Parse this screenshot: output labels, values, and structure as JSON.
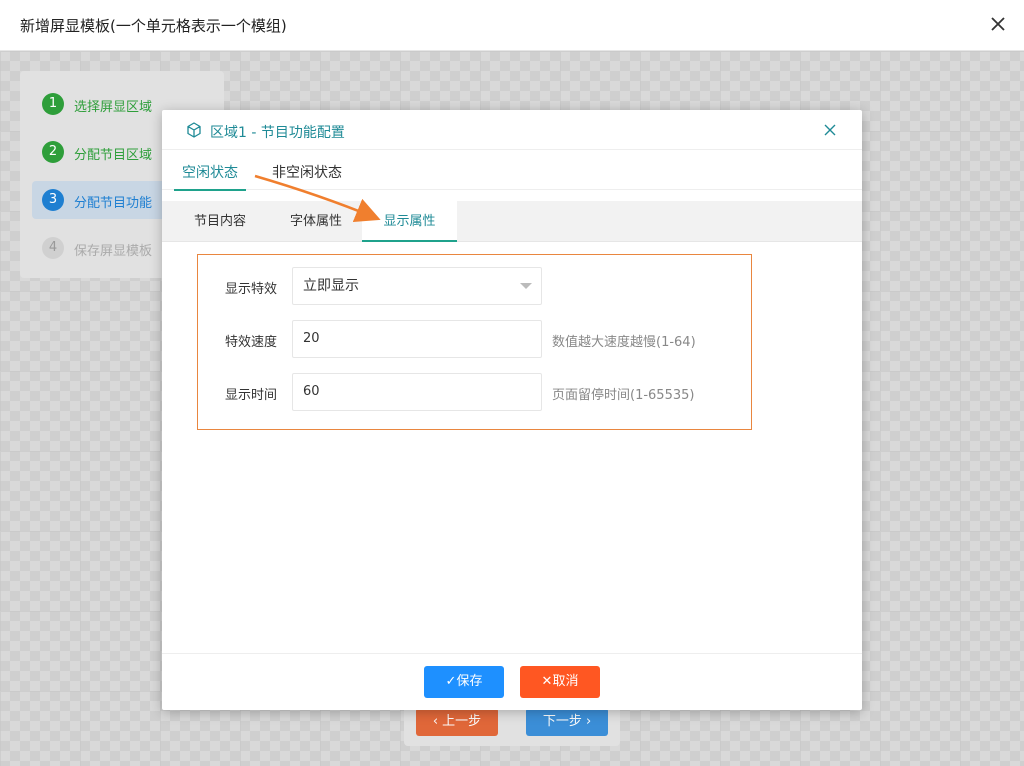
{
  "window": {
    "title": "新增屏显模板(一个单元格表示一个模组)"
  },
  "steps": [
    {
      "num": "1",
      "label": "选择屏显区域",
      "state": "done"
    },
    {
      "num": "2",
      "label": "分配节目区域",
      "state": "done"
    },
    {
      "num": "3",
      "label": "分配节目功能",
      "state": "active"
    },
    {
      "num": "4",
      "label": "保存屏显模板",
      "state": "todo"
    }
  ],
  "nav": {
    "prev": "上一步",
    "next": "下一步"
  },
  "dialog": {
    "title": "区域1 - 节目功能配置",
    "state_tabs": [
      {
        "label": "空闲状态",
        "active": true
      },
      {
        "label": "非空闲状态",
        "active": false
      }
    ],
    "sub_tabs": [
      {
        "label": "节目内容",
        "active": false
      },
      {
        "label": "字体属性",
        "active": false
      },
      {
        "label": "显示属性",
        "active": true
      }
    ],
    "form": {
      "effect": {
        "label": "显示特效",
        "value": "立即显示"
      },
      "speed": {
        "label": "特效速度",
        "value": "20",
        "hint": "数值越大速度越慢(1-64)"
      },
      "duration": {
        "label": "显示时间",
        "value": "60",
        "hint": "页面留停时间(1-65535)"
      }
    },
    "buttons": {
      "save": "保存",
      "cancel": "取消"
    }
  },
  "colors": {
    "accent": "#1e8a96",
    "save": "#1e90ff",
    "cancel": "#ff5722",
    "highlight_box": "#e9863f",
    "annotation_arrow": "#f07f2e"
  }
}
